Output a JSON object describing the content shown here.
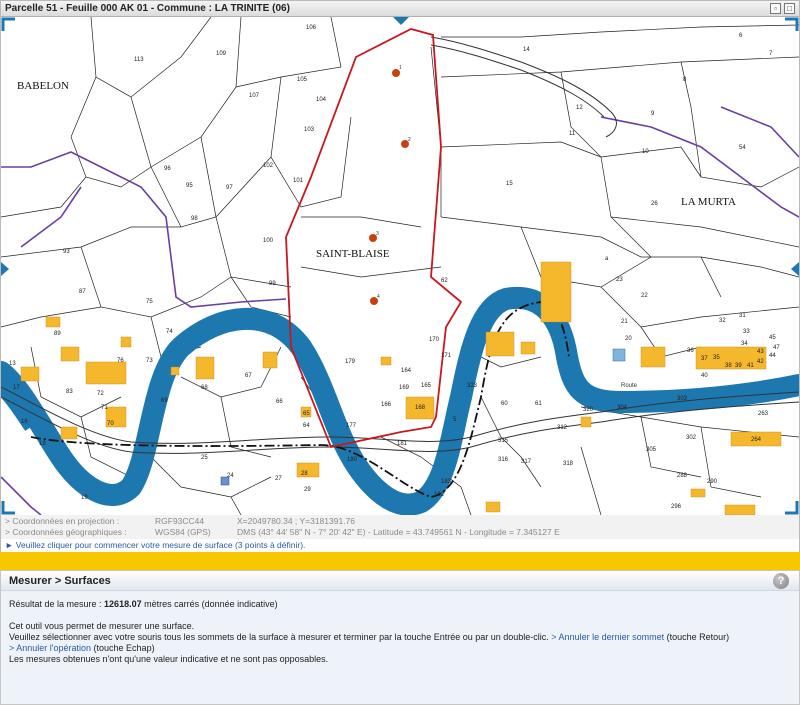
{
  "window": {
    "title": "Parcelle 51 - Feuille 000 AK 01 - Commune : LA TRINITE (06)"
  },
  "map": {
    "place_names": [
      "BABELON",
      "SAINT-BLAISE",
      "LA MURTA"
    ],
    "road_label": "Route",
    "parcels": [
      "106",
      "14",
      "113",
      "109",
      "107",
      "105",
      "104",
      "103",
      "102",
      "101",
      "96",
      "95",
      "97",
      "98",
      "100",
      "99",
      "93",
      "87",
      "75",
      "74",
      "89",
      "76",
      "73",
      "72",
      "71",
      "70",
      "13",
      "17",
      "18",
      "83",
      "16",
      "67",
      "69",
      "68",
      "66",
      "64",
      "65",
      "179",
      "171",
      "170",
      "169",
      "164",
      "165",
      "166",
      "168",
      "177",
      "181",
      "180",
      "183",
      "182",
      "315",
      "316",
      "317",
      "318",
      "312",
      "304",
      "303",
      "305",
      "302",
      "288",
      "290",
      "296",
      "320",
      "263",
      "264",
      "26",
      "25",
      "24",
      "23",
      "22",
      "21",
      "20",
      "19",
      "27",
      "28",
      "29",
      "8",
      "9",
      "10",
      "11",
      "12",
      "15",
      "54",
      "6",
      "7",
      "31",
      "32",
      "33",
      "34",
      "35",
      "36",
      "37",
      "38",
      "39",
      "40",
      "41",
      "42",
      "43",
      "44",
      "45",
      "47",
      "323",
      "60",
      "61",
      "62",
      "5",
      "a",
      "b"
    ],
    "survey_points": [
      "1",
      "2",
      "3",
      "4"
    ]
  },
  "coords": {
    "projection_label": "> Coordonnées en projection :",
    "projection_system": "RGF93CC44",
    "projection_value": "X=2049780.34 ; Y=3181391.76",
    "geo_label": "> Coordonnées géographiques :",
    "geo_system": "WGS84 (GPS)",
    "geo_value": "DMS (43° 44' 58\" N - 7° 20' 42\" E) - Latitude = 43.749561 N - Longitude = 7.345127 E"
  },
  "status": {
    "text": "► Veuillez cliquer pour commencer votre mesure de surface (3 points à définir)."
  },
  "panel": {
    "title": "Mesurer > Surfaces",
    "result_prefix": "Résultat de la mesure : ",
    "result_value": "12618.07",
    "result_suffix": " mètres carrés (donnée indicative)",
    "line1": "Cet outil vous permet de mesurer une surface.",
    "line2": "Veuillez sélectionner avec votre souris tous les sommets de la surface à mesurer et terminer par la touche Entrée ou par un double-clic.",
    "undo_link": "> Annuler le dernier sommet",
    "undo_key": " (touche Retour)",
    "cancel_link": "> Annuler l'opération",
    "cancel_key": " (touche Echap)",
    "line4": "Les mesures obtenues n'ont qu'une valeur indicative et ne sont pas opposables."
  },
  "colors": {
    "river": "#1e78b0",
    "boundary": "#6a3ea0",
    "measure": "#c8181e",
    "building": "#f5b72c",
    "accent_bar": "#f6c800"
  }
}
